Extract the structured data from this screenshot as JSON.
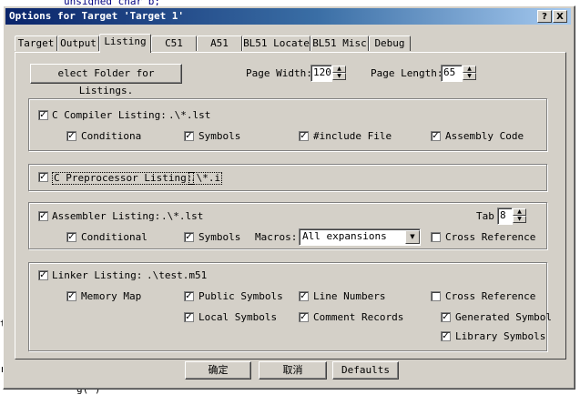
{
  "background": {
    "code_lines": [
      "unsigned char b;",
      "t",
      "r",
      "g(*)"
    ]
  },
  "window": {
    "title": "Options for Target 'Target 1'",
    "help_btn": "?",
    "close_btn": "X"
  },
  "tabs": [
    "Target",
    "Output",
    "Listing",
    "C51",
    "A51",
    "BL51 Locate",
    "BL51 Misc",
    "Debug"
  ],
  "active_tab": "Listing",
  "top": {
    "select_folder": "elect Folder for Listings.",
    "page_width_label": "Page Width:",
    "page_width": "120",
    "page_length_label": "Page Length:",
    "page_length": "65"
  },
  "c_compiler": {
    "label": "C Compiler Listing:",
    "path": ".\\*.lst",
    "checked": true,
    "options": [
      {
        "label": "Conditiona",
        "checked": true
      },
      {
        "label": "Symbols",
        "checked": true
      },
      {
        "label": "#include File",
        "checked": true
      },
      {
        "label": "Assembly Code",
        "checked": true
      }
    ]
  },
  "c_preprocessor": {
    "label": "C Preprocessor Listing:",
    "path": ".\\*.i",
    "checked": true
  },
  "assembler": {
    "label": "Assembler Listing:",
    "path": ".\\*.lst",
    "checked": true,
    "tab_label": "Tab",
    "tab_value": "8",
    "conditional": "Conditional",
    "symbols": "Symbols",
    "macros_label": "Macros:",
    "macros_value": "All expansions",
    "cross_ref": "Cross Reference",
    "cross_ref_checked": false
  },
  "linker": {
    "label": "Linker Listing:",
    "path": ".\\test.m51",
    "checked": true,
    "memory_map": "Memory Map",
    "public_symbols": "Public Symbols",
    "line_numbers": "Line Numbers",
    "cross_ref": "Cross Reference",
    "local_symbols": "Local Symbols",
    "comment_records": "Comment Records",
    "generated_symbol": "Generated Symbol",
    "library_symbols": "Library Symbols"
  },
  "buttons": {
    "ok": "确定",
    "cancel": "取消",
    "defaults": "Defaults"
  },
  "colors": {
    "dialog_face": "#d4d0c8",
    "title_start": "#0a246a",
    "title_end": "#a6caf0"
  }
}
